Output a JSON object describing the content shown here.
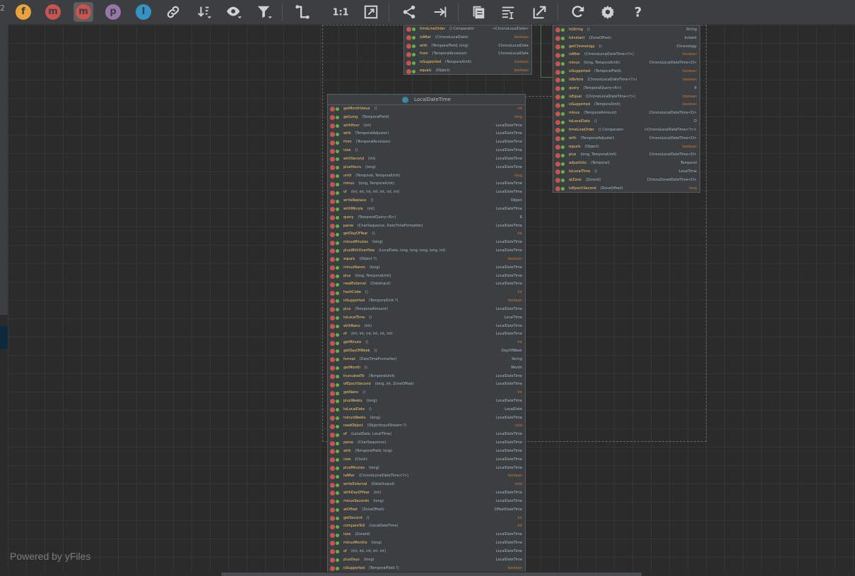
{
  "toolbar": {
    "left_edge_text": "2",
    "buttons": [
      {
        "name": "fields-filter",
        "glyph": "f",
        "color": "#e8a33d",
        "kind": "circle",
        "active": false
      },
      {
        "name": "constructors-filter",
        "glyph": "m",
        "color": "#c75450",
        "kind": "circle",
        "active": false
      },
      {
        "name": "methods-filter",
        "glyph": "m",
        "color": "#c75450",
        "kind": "circle",
        "active": true
      },
      {
        "name": "properties-filter",
        "glyph": "p",
        "color": "#9876aa",
        "kind": "circle",
        "active": false
      },
      {
        "name": "inner-classes-filter",
        "glyph": "I",
        "color": "#3592c4",
        "kind": "circle",
        "active": false
      }
    ],
    "icon_buttons": [
      "link-icon",
      "sort-icon",
      "eye-icon",
      "filter-icon",
      "edge-route-icon",
      "actual-size-icon",
      "fit-content-icon",
      "hierarchy-layout-icon",
      "merge-edges-icon",
      "copy-icon",
      "apply-layout-icon",
      "export-icon",
      "refresh-icon",
      "settings-icon",
      "help-icon"
    ]
  },
  "watermark": "Powered by yFiles",
  "colors": {
    "method_icon": "#c75450",
    "visibility_icon": "#62b543",
    "method_name": "#ffc66d",
    "type": "#a9b7c6",
    "primitive": "#cc7832"
  },
  "nodes": {
    "chrono_top": {
      "rows": [
        {
          "name": "timeLineOrder",
          "params": "() Comparator",
          "type": "<ChronoLocalDate>",
          "prim": false
        },
        {
          "name": "isAfter",
          "params": "(ChronoLocalDate)",
          "type": "boolean",
          "prim": true
        },
        {
          "name": "with",
          "params": "(TemporalField, long)",
          "type": "ChronoLocalDate",
          "prim": false
        },
        {
          "name": "from",
          "params": "(TemporalAccessor)",
          "type": "ChronoLocalDate",
          "prim": false
        },
        {
          "name": "isSupported",
          "params": "(TemporalUnit)",
          "type": "boolean",
          "prim": true
        },
        {
          "name": "equals",
          "params": "(Object)",
          "type": "boolean",
          "prim": true
        }
      ]
    },
    "chrono_right": {
      "rows": [
        {
          "name": "toString",
          "params": "()",
          "type": "String",
          "prim": false
        },
        {
          "name": "toInstant",
          "params": "(ZoneOffset)",
          "type": "Instant",
          "prim": false
        },
        {
          "name": "getChronology",
          "params": "()",
          "type": "Chronology",
          "prim": false
        },
        {
          "name": "isAfter",
          "params": "(ChronoLocalDateTime<?>)",
          "type": "boolean",
          "prim": true
        },
        {
          "name": "minus",
          "params": "(long, TemporalUnit)",
          "type": "ChronoLocalDateTime<D>",
          "prim": false
        },
        {
          "name": "isSupported",
          "params": "(TemporalField)",
          "type": "boolean",
          "prim": true
        },
        {
          "name": "isBefore",
          "params": "(ChronoLocalDateTime<?>)",
          "type": "boolean",
          "prim": true
        },
        {
          "name": "query",
          "params": "(TemporalQuery<R>)",
          "type": "R",
          "prim": false
        },
        {
          "name": "isEqual",
          "params": "(ChronoLocalDateTime<?>)",
          "type": "boolean",
          "prim": true
        },
        {
          "name": "isSupported",
          "params": "(TemporalUnit)",
          "type": "boolean",
          "prim": true
        },
        {
          "name": "minus",
          "params": "(TemporalAmount)",
          "type": "ChronoLocalDateTime<D>",
          "prim": false
        },
        {
          "name": "toLocalDate",
          "params": "()",
          "type": "D",
          "prim": false
        },
        {
          "name": "timeLineOrder",
          "params": "() Comparator",
          "type": "<ChronoLocalDateTime<?>>",
          "prim": false
        },
        {
          "name": "with",
          "params": "(TemporalAdjuster)",
          "type": "ChronoLocalDateTime<D>",
          "prim": false
        },
        {
          "name": "equals",
          "params": "(Object)",
          "type": "boolean",
          "prim": true
        },
        {
          "name": "plus",
          "params": "(long, TemporalUnit)",
          "type": "ChronoLocalDateTime<D>",
          "prim": false
        },
        {
          "name": "adjustInto",
          "params": "(Temporal)",
          "type": "Temporal",
          "prim": false
        },
        {
          "name": "toLocalTime",
          "params": "()",
          "type": "LocalTime",
          "prim": false
        },
        {
          "name": "atZone",
          "params": "(ZoneId)",
          "type": "ChronoZonedDateTime<D>",
          "prim": false
        },
        {
          "name": "toEpochSecond",
          "params": "(ZoneOffset)",
          "type": "long",
          "prim": true
        }
      ]
    },
    "localdatetime": {
      "title": "LocalDateTime",
      "rows": [
        {
          "name": "getMonthValue",
          "params": "()",
          "type": "int",
          "prim": true
        },
        {
          "name": "getLong",
          "params": "(TemporalField)",
          "type": "long",
          "prim": true
        },
        {
          "name": "withHour",
          "params": "(int)",
          "type": "LocalDateTime",
          "prim": false
        },
        {
          "name": "with",
          "params": "(TemporalAdjuster)",
          "type": "LocalDateTime",
          "prim": false
        },
        {
          "name": "from",
          "params": "(TemporalAccessor)",
          "type": "LocalDateTime",
          "prim": false
        },
        {
          "name": "now",
          "params": "()",
          "type": "LocalDateTime",
          "prim": false
        },
        {
          "name": "withSecond",
          "params": "(int)",
          "type": "LocalDateTime",
          "prim": false
        },
        {
          "name": "plusHours",
          "params": "(long)",
          "type": "LocalDateTime",
          "prim": false
        },
        {
          "name": "until",
          "params": "(Temporal, TemporalUnit)",
          "type": "long",
          "prim": true
        },
        {
          "name": "minus",
          "params": "(long, TemporalUnit)",
          "type": "LocalDateTime",
          "prim": false
        },
        {
          "name": "of",
          "params": "(int, int, int, int, int, int, int)",
          "type": "LocalDateTime",
          "prim": false
        },
        {
          "name": "writeReplace",
          "params": "()",
          "type": "Object",
          "prim": false
        },
        {
          "name": "withMinute",
          "params": "(int)",
          "type": "LocalDateTime",
          "prim": false
        },
        {
          "name": "query",
          "params": "(TemporalQuery<R>)",
          "type": "R",
          "prim": false
        },
        {
          "name": "parse",
          "params": "(CharSequence, DateTimeFormatter)",
          "type": "LocalDateTime",
          "prim": false
        },
        {
          "name": "getDayOfYear",
          "params": "()",
          "type": "int",
          "prim": true
        },
        {
          "name": "minusMinutes",
          "params": "(long)",
          "type": "LocalDateTime",
          "prim": false
        },
        {
          "name": "plusWithOverflow",
          "params": "(LocalDate, long, long, long, long, int)",
          "type": "LocalDateTime",
          "prim": false
        },
        {
          "name": "equals",
          "params": "(Object ?)",
          "type": "boolean",
          "prim": true
        },
        {
          "name": "minusNanos",
          "params": "(long)",
          "type": "LocalDateTime",
          "prim": false
        },
        {
          "name": "plus",
          "params": "(long, TemporalUnit)",
          "type": "LocalDateTime",
          "prim": false
        },
        {
          "name": "readExternal",
          "params": "(DataInput)",
          "type": "LocalDateTime",
          "prim": false
        },
        {
          "name": "hashCode",
          "params": "()",
          "type": "int",
          "prim": true
        },
        {
          "name": "isSupported",
          "params": "(TemporalUnit ?)",
          "type": "boolean",
          "prim": true
        },
        {
          "name": "plus",
          "params": "(TemporalAmount)",
          "type": "LocalDateTime",
          "prim": false
        },
        {
          "name": "toLocalTime",
          "params": "()",
          "type": "LocalTime",
          "prim": false
        },
        {
          "name": "withNano",
          "params": "(int)",
          "type": "LocalDateTime",
          "prim": false
        },
        {
          "name": "of",
          "params": "(int, int, int, int, int, int)",
          "type": "LocalDateTime",
          "prim": false
        },
        {
          "name": "getMinute",
          "params": "()",
          "type": "int",
          "prim": true
        },
        {
          "name": "getDayOfWeek",
          "params": "()",
          "type": "DayOfWeek",
          "prim": false
        },
        {
          "name": "format",
          "params": "(DateTimeFormatter)",
          "type": "String",
          "prim": false
        },
        {
          "name": "getMonth",
          "params": "()",
          "type": "Month",
          "prim": false
        },
        {
          "name": "truncatedTo",
          "params": "(TemporalUnit)",
          "type": "LocalDateTime",
          "prim": false
        },
        {
          "name": "ofEpochSecond",
          "params": "(long, int, ZoneOffset)",
          "type": "LocalDateTime",
          "prim": false
        },
        {
          "name": "getNano",
          "params": "()",
          "type": "int",
          "prim": true
        },
        {
          "name": "plusWeeks",
          "params": "(long)",
          "type": "LocalDateTime",
          "prim": false
        },
        {
          "name": "toLocalDate",
          "params": "()",
          "type": "LocalDate",
          "prim": false
        },
        {
          "name": "minusWeeks",
          "params": "(long)",
          "type": "LocalDateTime",
          "prim": false
        },
        {
          "name": "readObject",
          "params": "(ObjectInputStream ?)",
          "type": "void",
          "prim": true
        },
        {
          "name": "of",
          "params": "(LocalDate, LocalTime)",
          "type": "LocalDateTime",
          "prim": false
        },
        {
          "name": "parse",
          "params": "(CharSequence)",
          "type": "LocalDateTime",
          "prim": false
        },
        {
          "name": "with",
          "params": "(TemporalField, long)",
          "type": "LocalDateTime",
          "prim": false
        },
        {
          "name": "now",
          "params": "(Clock)",
          "type": "LocalDateTime",
          "prim": false
        },
        {
          "name": "plusMinutes",
          "params": "(long)",
          "type": "LocalDateTime",
          "prim": false
        },
        {
          "name": "isAfter",
          "params": "(ChronoLocalDateTime<?>)",
          "type": "boolean",
          "prim": true
        },
        {
          "name": "writeExternal",
          "params": "(DataOutput)",
          "type": "void",
          "prim": true
        },
        {
          "name": "withDayOfYear",
          "params": "(int)",
          "type": "LocalDateTime",
          "prim": false
        },
        {
          "name": "minusSeconds",
          "params": "(long)",
          "type": "LocalDateTime",
          "prim": false
        },
        {
          "name": "atOffset",
          "params": "(ZoneOffset)",
          "type": "OffsetDateTime",
          "prim": false
        },
        {
          "name": "getSecond",
          "params": "()",
          "type": "int",
          "prim": true
        },
        {
          "name": "compareTo0",
          "params": "(LocalDateTime)",
          "type": "int",
          "prim": true
        },
        {
          "name": "now",
          "params": "(ZoneId)",
          "type": "LocalDateTime",
          "prim": false
        },
        {
          "name": "minusMonths",
          "params": "(long)",
          "type": "LocalDateTime",
          "prim": false
        },
        {
          "name": "of",
          "params": "(int, int, int, int, int)",
          "type": "LocalDateTime",
          "prim": false
        },
        {
          "name": "plusDays",
          "params": "(long)",
          "type": "LocalDateTime",
          "prim": false
        },
        {
          "name": "isSupported",
          "params": "(TemporalField ?)",
          "type": "boolean",
          "prim": true
        }
      ]
    }
  }
}
